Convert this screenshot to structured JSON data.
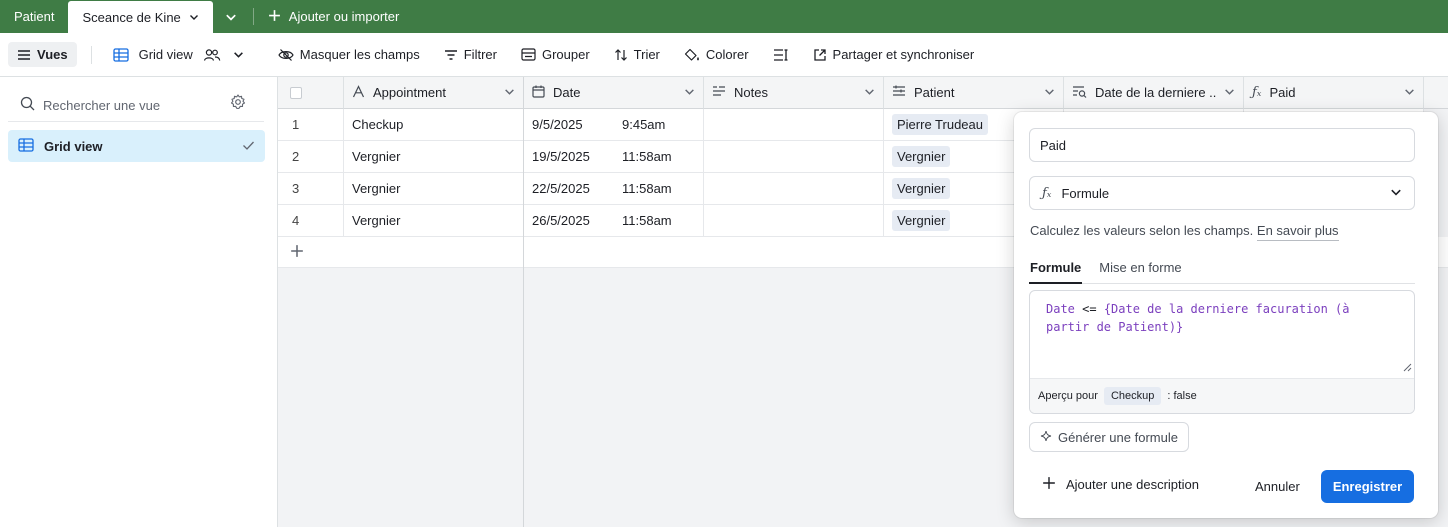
{
  "tabs": {
    "items": [
      {
        "label": "Patient"
      },
      {
        "label": "Sceance de Kine"
      }
    ],
    "add_import_label": "Ajouter ou importer"
  },
  "toolbar": {
    "views_label": "Vues",
    "grid_view_label": "Grid view",
    "hide_fields_label": "Masquer les champs",
    "filter_label": "Filtrer",
    "group_label": "Grouper",
    "sort_label": "Trier",
    "color_label": "Colorer",
    "share_label": "Partager et synchroniser"
  },
  "sidebar": {
    "search_placeholder": "Rechercher une vue",
    "views": [
      {
        "label": "Grid view"
      }
    ]
  },
  "grid": {
    "columns": [
      {
        "label": "Appointment"
      },
      {
        "label": "Date"
      },
      {
        "label": "Notes"
      },
      {
        "label": "Patient"
      },
      {
        "label": "Date de la derniere ..."
      },
      {
        "label": "Paid"
      }
    ],
    "rows": [
      {
        "num": "1",
        "appointment": "Checkup",
        "date": "9/5/2025",
        "time": "9:45am",
        "notes": "",
        "patient": "Pierre Trudeau"
      },
      {
        "num": "2",
        "appointment": "Vergnier",
        "date": "19/5/2025",
        "time": "11:58am",
        "notes": "",
        "patient": "Vergnier"
      },
      {
        "num": "3",
        "appointment": "Vergnier",
        "date": "22/5/2025",
        "time": "11:58am",
        "notes": "",
        "patient": "Vergnier"
      },
      {
        "num": "4",
        "appointment": "Vergnier",
        "date": "26/5/2025",
        "time": "11:58am",
        "notes": "",
        "patient": "Vergnier"
      }
    ]
  },
  "popover": {
    "field_name_value": "Paid",
    "field_type_label": "Formule",
    "help_text": "Calculez les valeurs selon les champs.",
    "help_link": "En savoir plus",
    "tabs": [
      {
        "label": "Formule"
      },
      {
        "label": "Mise en forme"
      }
    ],
    "formula": {
      "field_ref": "Date",
      "operator": "<=",
      "rhs": "{Date de la derniere facuration (à partir de Patient)}"
    },
    "preview_label": "Aperçu pour",
    "preview_record": "Checkup",
    "preview_result": ": false",
    "generate_label": "Générer une formule",
    "add_description_label": "Ajouter une description",
    "cancel_label": "Annuler",
    "save_label": "Enregistrer"
  },
  "colors": {
    "topbar": "#3f7c45",
    "primary_button": "#166ee1",
    "selected_view": "#d9f0fc",
    "formula_text": "#7b3fbe"
  }
}
